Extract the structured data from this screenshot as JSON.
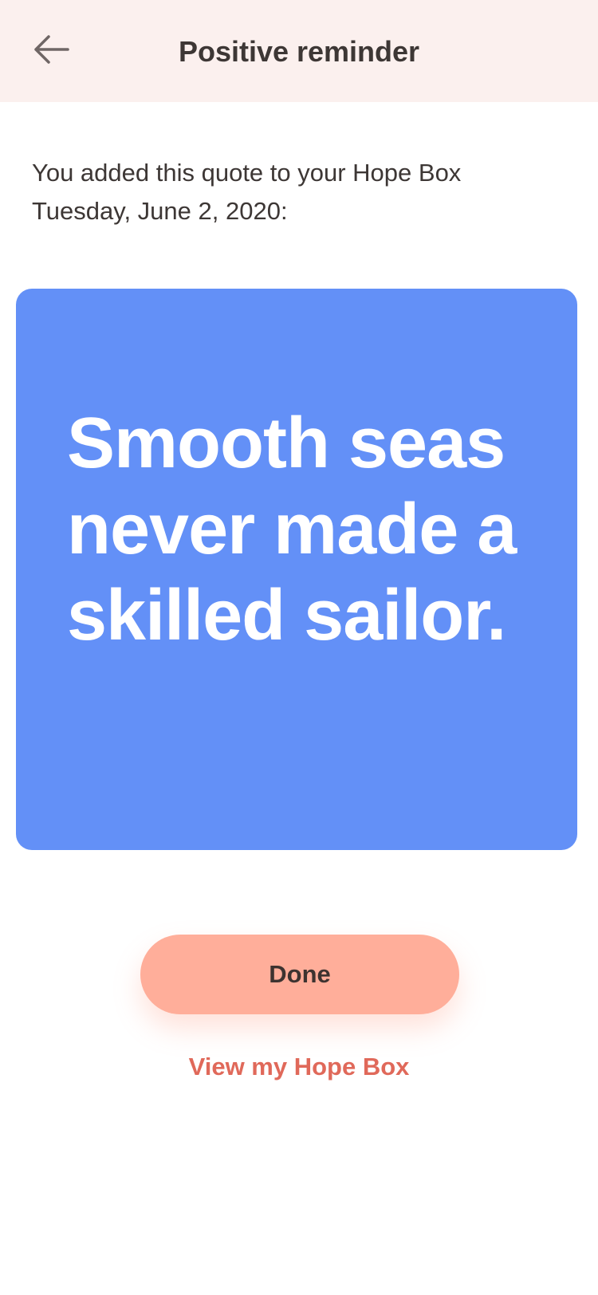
{
  "header": {
    "title": "Positive reminder",
    "back_icon": "arrow-left-icon",
    "background_color": "#fbf0ee"
  },
  "intro": {
    "line1": "You added this quote to your Hope Box",
    "line2": "Tuesday, June 2, 2020:"
  },
  "quote": {
    "text": "Smooth seas never made a skilled sailor.",
    "background_color": "#6390f7",
    "text_color": "#ffffff"
  },
  "actions": {
    "done_label": "Done",
    "done_color": "#ffae9a",
    "link_label": "View my Hope Box",
    "link_color": "#e0695a"
  }
}
